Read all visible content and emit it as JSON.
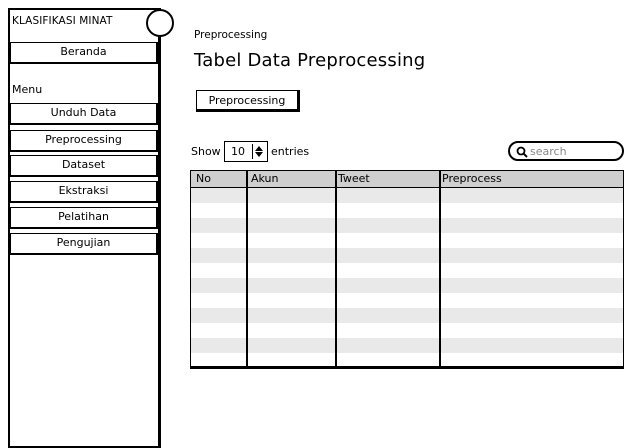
{
  "app": {
    "title": "KLASIFIKASI MINAT"
  },
  "sidebar": {
    "top_item": "Beranda",
    "menu_heading": "Menu",
    "items": [
      {
        "label": "Unduh Data"
      },
      {
        "label": "Preprocessing"
      },
      {
        "label": "Dataset"
      },
      {
        "label": "Ekstraksi"
      },
      {
        "label": "Pelatihan"
      },
      {
        "label": "Pengujian"
      }
    ]
  },
  "main": {
    "breadcrumb": "Preprocessing",
    "title": "Tabel Data Preprocessing",
    "action_button": "Preprocessing",
    "show_label": "Show",
    "entries_value": "10",
    "entries_label": "entries",
    "search_placeholder": "search",
    "table": {
      "columns": [
        "No",
        "Akun",
        "Tweet",
        "Preprocess"
      ],
      "rows": []
    }
  },
  "colors": {
    "header_bg": "#cfcfcf",
    "stripe": "#e9e9e9"
  },
  "icons": {
    "search": "search-icon",
    "spinner": "spinner-icon",
    "logo": "logo-circle"
  }
}
